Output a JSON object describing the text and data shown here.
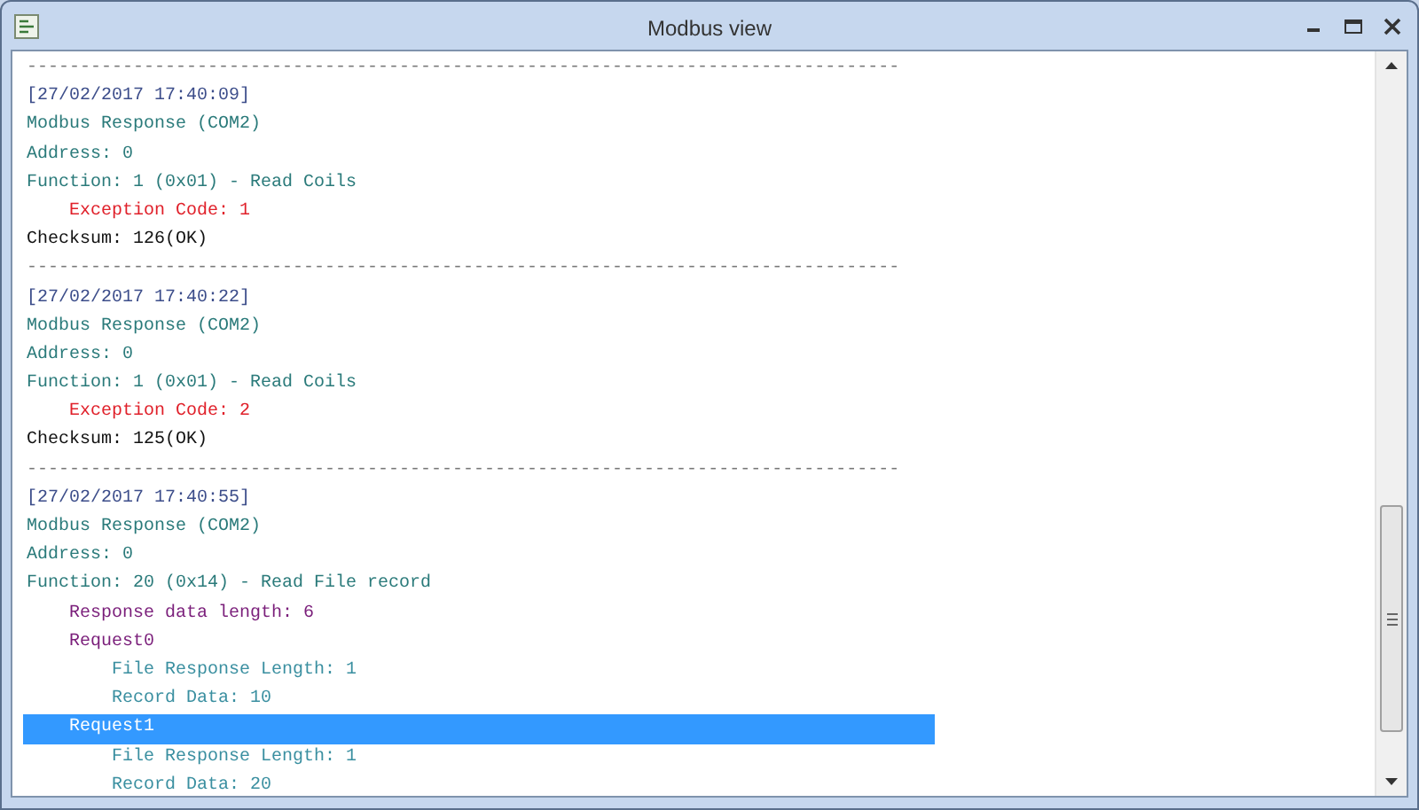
{
  "window": {
    "title": "Modbus view"
  },
  "log": [
    {
      "kind": "separator",
      "text": "----------------------------------------------------------------------------------",
      "selected": false
    },
    {
      "kind": "timestamp",
      "text": "[27/02/2017 17:40:09]",
      "selected": false
    },
    {
      "kind": "header",
      "text": "Modbus Response (COM2)",
      "selected": false
    },
    {
      "kind": "header",
      "text": "Address: 0",
      "selected": false
    },
    {
      "kind": "header",
      "text": "Function: 1 (0x01) - Read Coils",
      "selected": false,
      "children": [
        {
          "kind": "error",
          "text": "Exception Code: 1",
          "selected": false
        }
      ]
    },
    {
      "kind": "checksum",
      "text": "Checksum: 126(OK)",
      "selected": false
    },
    {
      "kind": "separator",
      "text": "----------------------------------------------------------------------------------",
      "selected": false
    },
    {
      "kind": "timestamp",
      "text": "[27/02/2017 17:40:22]",
      "selected": false
    },
    {
      "kind": "header",
      "text": "Modbus Response (COM2)",
      "selected": false
    },
    {
      "kind": "header",
      "text": "Address: 0",
      "selected": false
    },
    {
      "kind": "header",
      "text": "Function: 1 (0x01) - Read Coils",
      "selected": false,
      "children": [
        {
          "kind": "error",
          "text": "Exception Code: 2",
          "selected": false
        }
      ]
    },
    {
      "kind": "checksum",
      "text": "Checksum: 125(OK)",
      "selected": false
    },
    {
      "kind": "separator",
      "text": "----------------------------------------------------------------------------------",
      "selected": false
    },
    {
      "kind": "timestamp",
      "text": "[27/02/2017 17:40:55]",
      "selected": false
    },
    {
      "kind": "header",
      "text": "Modbus Response (COM2)",
      "selected": false
    },
    {
      "kind": "header",
      "text": "Address: 0",
      "selected": false
    },
    {
      "kind": "header",
      "text": "Function: 20 (0x14) - Read File record",
      "selected": false,
      "children": [
        {
          "kind": "field",
          "text": "Response data length: 6",
          "selected": false
        },
        {
          "kind": "field",
          "text": "Request0",
          "selected": false,
          "children": [
            {
              "kind": "detail",
              "text": "File Response Length: 1",
              "selected": false
            },
            {
              "kind": "detail",
              "text": "Record Data: 10",
              "selected": false
            }
          ]
        },
        {
          "kind": "field",
          "text": "Request1",
          "selected": true,
          "children": [
            {
              "kind": "detail",
              "text": "File Response Length: 1",
              "selected": false
            },
            {
              "kind": "detail",
              "text": "Record Data: 20",
              "selected": false
            }
          ]
        }
      ]
    }
  ]
}
